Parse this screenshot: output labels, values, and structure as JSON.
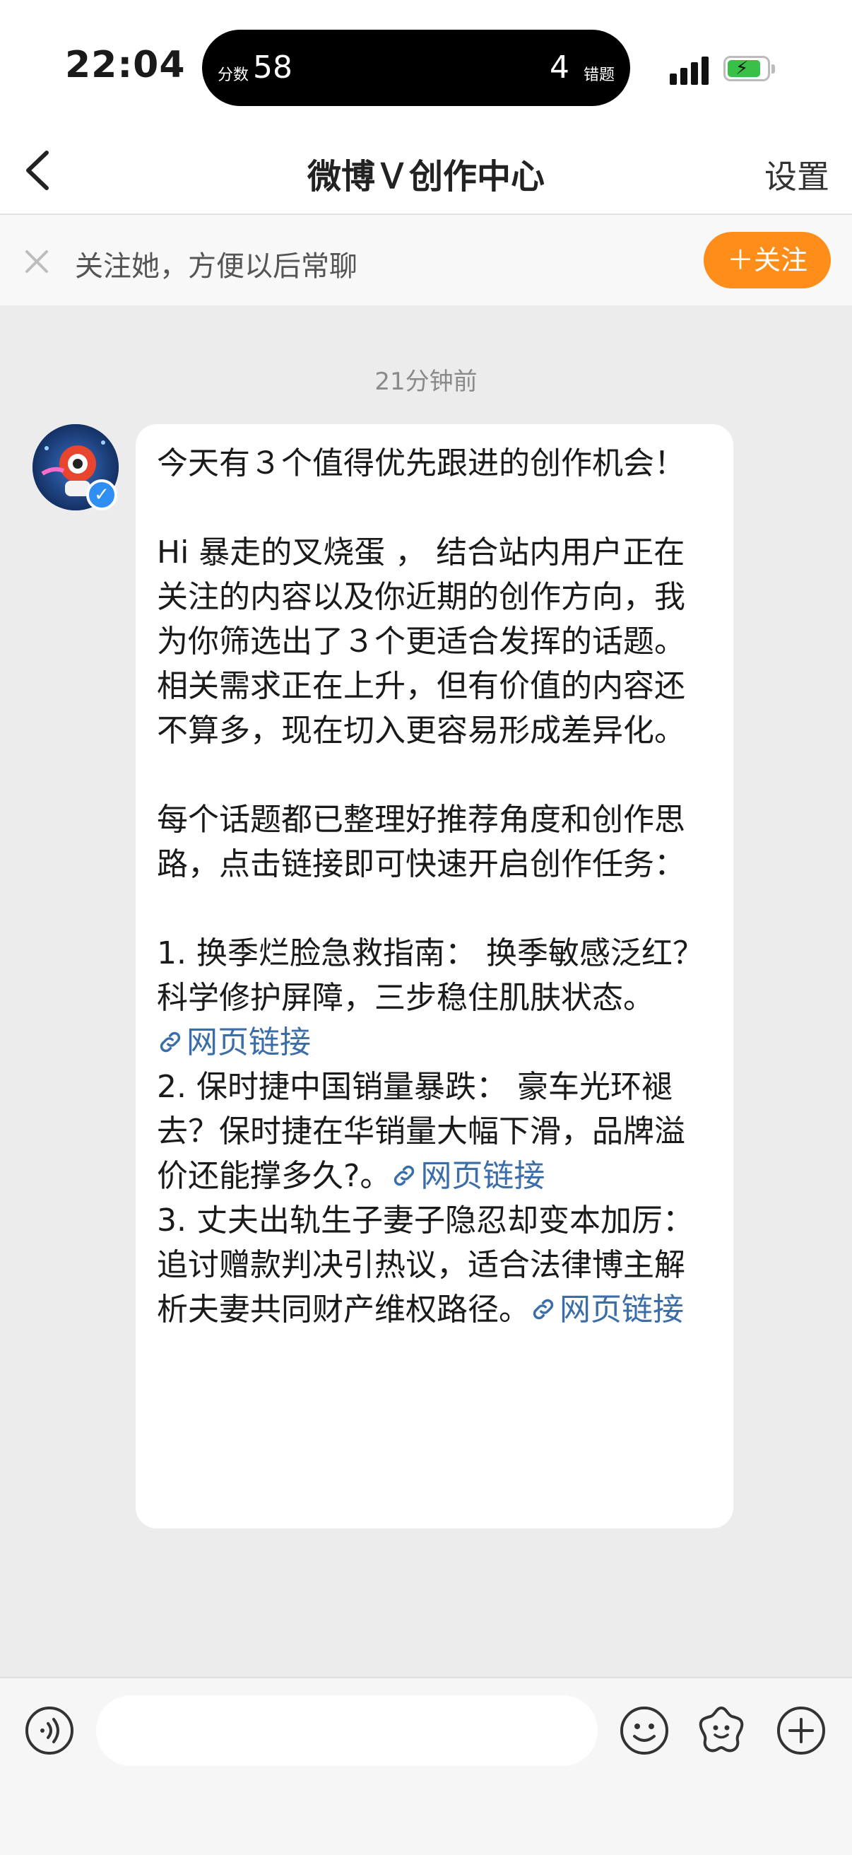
{
  "status_bar": {
    "time": "22:04",
    "score_label": "分数",
    "score": "58",
    "errors": "4",
    "errors_label": "错题"
  },
  "nav": {
    "title": "微博Ｖ创作中心",
    "settings_label": "设置"
  },
  "follow_bar": {
    "text": "关注她，方便以后常聊",
    "button_label": "＋关注"
  },
  "chat": {
    "timestamp": "21分钟前",
    "message": {
      "intro": "今天有３个值得优先跟进的创作机会！",
      "greeting": "Hi 暴走的叉烧蛋 ， 结合站内用户正在关注的内容以及你近期的创作方向，我为你筛选出了３个更适合发挥的话题。相关需求正在上升，但有价值的内容还不算多，现在切入更容易形成差异化。",
      "instruction": "每个话题都已整理好推荐角度和创作思路，点击链接即可快速开启创作任务：",
      "topics": [
        {
          "text": "1. 换季烂脸急救指南： 换季敏感泛红？科学修护屏障，三步稳住肌肤状态。",
          "link": "网页链接"
        },
        {
          "text": "2. 保时捷中国销量暴跌： 豪车光环褪去？保时捷在华销量大幅下滑，品牌溢价还能撑多久?。",
          "link": "网页链接"
        },
        {
          "text": "3. 丈夫出轨生子妻子隐忍却变本加厉： 追讨赠款判决引热议，适合法律博主解析夫妻共同财产维权路径。",
          "link": "网页链接"
        }
      ]
    }
  },
  "colors": {
    "accent_orange": "#ff8d1a",
    "link_blue": "#3b6ea8",
    "verified_blue": "#2e8ef2",
    "battery_green": "#38c049",
    "chat_background": "#ececec"
  },
  "icons": {
    "back": "chevron-left-icon",
    "close": "close-icon",
    "link": "link-icon",
    "voice": "voice-icon",
    "emoji": "emoji-icon",
    "sticker": "sticker-icon",
    "plus": "plus-icon"
  }
}
